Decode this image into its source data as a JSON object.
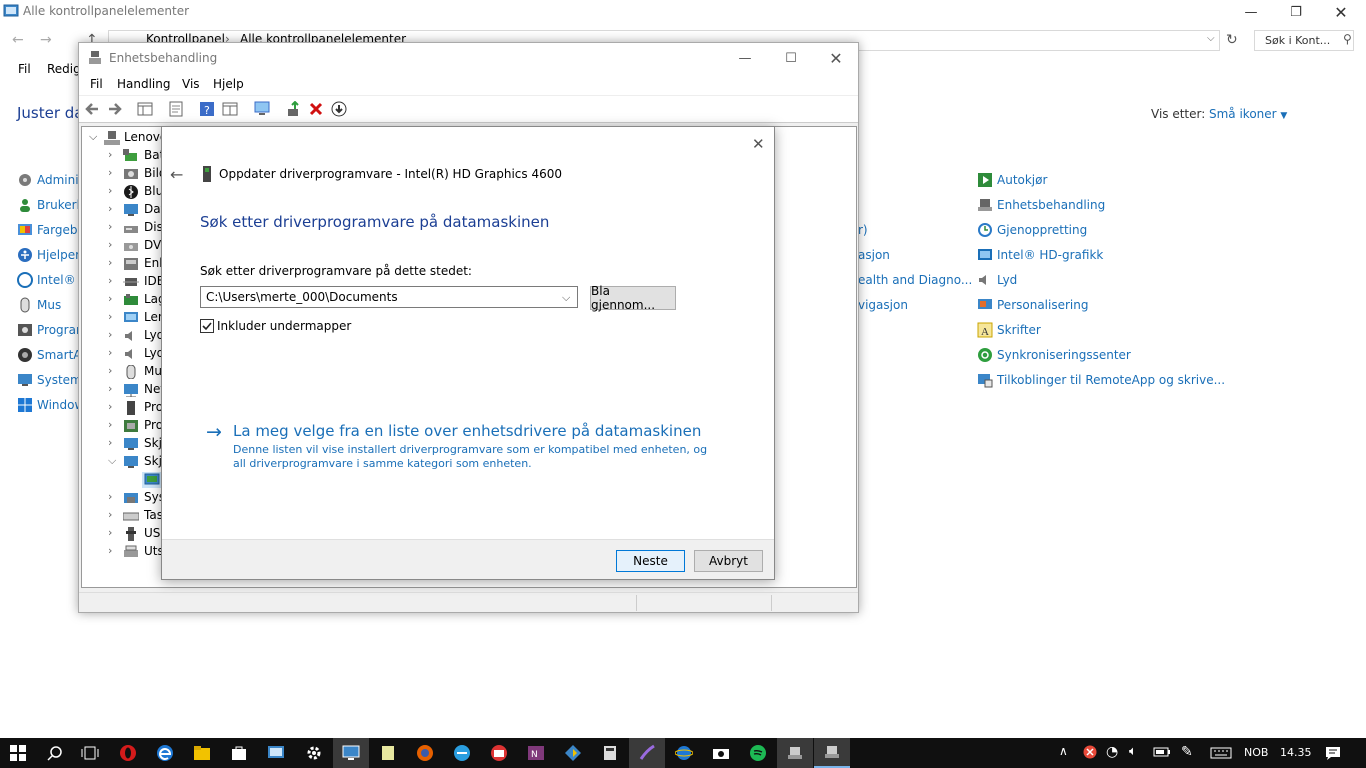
{
  "control_panel": {
    "title": "Alle kontrollpanelelementer",
    "breadcrumb": [
      "Kontrollpanel",
      "Alle kontrollpanelelementer"
    ],
    "search_placeholder": "Søk i Kont...",
    "menu": [
      "Fil",
      "Redige"
    ],
    "heading": "Juster da",
    "view_by_label": "Vis etter:",
    "view_by_value": "Små ikoner",
    "left_items": [
      "Adminis",
      "Brukerko",
      "Fargebe",
      "Hjelpem",
      "Intel® R",
      "Mus",
      "Program",
      "SmartAu",
      "System",
      "Window"
    ],
    "mid_items": [
      "r)",
      "asjon",
      "ealth and Diagno...",
      "vigasjon"
    ],
    "right_items": [
      "Autokjør",
      "Enhetsbehandling",
      "Gjenoppretting",
      "Intel® HD-grafikk",
      "Lyd",
      "Personalisering",
      "Skrifter",
      "Synkroniseringssenter",
      "Tilkoblinger til RemoteApp og skrive..."
    ]
  },
  "device_manager": {
    "title": "Enhetsbehandling",
    "menu": [
      "Fil",
      "Handling",
      "Vis",
      "Hjelp"
    ],
    "tree_root": "Lenovo",
    "tree_items": [
      "Batt",
      "Bild",
      "Blue",
      "Dat",
      "Disk",
      "DVD",
      "Enh",
      "IDE",
      "Lag",
      "Len",
      "Lyd",
      "Lyd",
      "Mu",
      "Net",
      "Pro",
      "Pro",
      "Skje",
      "Skje",
      "",
      "Syst",
      "Tast",
      "USB",
      "Utsk"
    ]
  },
  "wizard": {
    "device_title": "Oppdater driverprogramvare - Intel(R) HD Graphics 4600",
    "heading": "Søk etter driverprogramvare på datamaskinen",
    "location_label": "Søk etter driverprogramvare på dette stedet:",
    "path_value": "C:\\Users\\merte_000\\Documents",
    "browse_label": "Bla gjennom...",
    "include_subfolders_label": "Inkluder undermapper",
    "include_subfolders_checked": true,
    "pick_link": "La meg velge fra en liste over enhetsdrivere på datamaskinen",
    "pick_desc": "Denne listen vil vise installert driverprogramvare som er kompatibel med enheten, og all driverprogramvare i samme kategori som enheten.",
    "next_label": "Neste",
    "cancel_label": "Avbryt"
  },
  "taskbar": {
    "language": "NOB",
    "time": "14.35"
  },
  "colors": {
    "link": "#1a6fb8",
    "wizard_heading": "#1c3f94",
    "taskbar": "#101010"
  }
}
